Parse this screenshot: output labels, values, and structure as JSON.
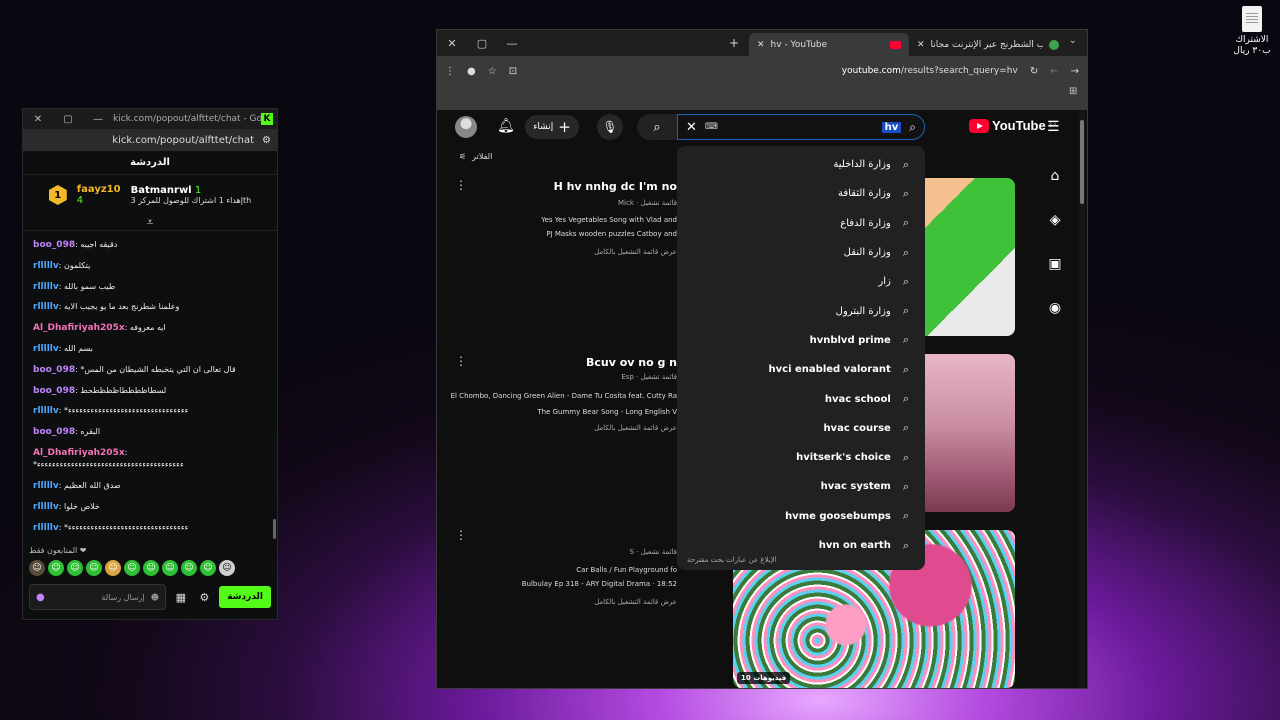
{
  "desktop": {
    "file_label": "الاشتراك ب٣٠ ريال"
  },
  "kick": {
    "window_title": "kick.com/popout/alfttet/chat - Google...",
    "url": "kick.com/popout/alfttet/chat",
    "chat_header": "الدردشة",
    "pinned": {
      "user1": "faayz10",
      "user1_count": "4",
      "user2": "Batmanrwl",
      "user2_count": "1",
      "text": "إهداء 1 اشتراك للوصول للمركز 3",
      "badge_text": "th"
    },
    "messages": [
      {
        "user": "boo_098",
        "color": "#c084fc",
        "text": "دقيقه اجيبه"
      },
      {
        "user": "rlllllv",
        "color": "#4ea8ff",
        "text": "يتكلمون"
      },
      {
        "user": "rlllllv",
        "color": "#4ea8ff",
        "text": "طيب سمو بالله"
      },
      {
        "user": "rlllllv",
        "color": "#4ea8ff",
        "text": "وعلمنا شطرنج بعد ما يو يجيب الايه"
      },
      {
        "user": "Al_Dhafiriyah205x",
        "color": "#f472b6",
        "text": "ايه معروفه"
      },
      {
        "user": "rlllllv",
        "color": "#4ea8ff",
        "text": "بسم الله"
      },
      {
        "user": "boo_098",
        "color": "#c084fc",
        "text": "*قال تعالى ان التي يتخبطه الشيطان من المس"
      },
      {
        "user": "boo_098",
        "color": "#c084fc",
        "text": "لسطاظطظطاظطظطحط"
      },
      {
        "user": "rlllllv",
        "color": "#4ea8ff",
        "text": "*ءءءءءءءءءءءءءءءءءءءءءءءءءءءءءءءء"
      },
      {
        "user": "boo_098",
        "color": "#c084fc",
        "text": "البقره"
      },
      {
        "user": "Al_Dhafiriyah205x",
        "color": "#f472b6",
        "text": "*ءءءءءءءءءءءءءءءءءءءءءءءءءءءءءءءءءءءءءءء"
      },
      {
        "user": "rlllllv",
        "color": "#4ea8ff",
        "text": "صدق الله العظيم"
      },
      {
        "user": "rlllllv",
        "color": "#4ea8ff",
        "text": "خلاص خلوا"
      },
      {
        "user": "rlllllv",
        "color": "#4ea8ff",
        "text": "*ءءءءءءءءءءءءءءءءءءءءءءءءءءءءءءءء"
      }
    ],
    "emotes_label": "المتابعون فقط ❤",
    "input_placeholder": "إرسال رسالة",
    "send_label": "الدردشة"
  },
  "browser": {
    "tabs": [
      {
        "title": "hv - YouTube",
        "active": true
      },
      {
        "title": "إلعب الشطرنج عبر الإنترنت مجاناً",
        "active": false
      }
    ],
    "url_domain": "youtube.com",
    "url_path": "/results?search_query=hv",
    "youtube": {
      "create_label": "إنشاء",
      "search_value": "hv",
      "keyboard_icon": "⌨",
      "logo_text": "YouTube",
      "region": "SA",
      "filters_label": "الفلاتر",
      "suggestions": [
        "وزارة الداخلية",
        "وزارة الثقافة",
        "وزارة الدفاع",
        "وزارة النقل",
        "زار",
        "وزارة البترول",
        "hvnblvd prime",
        "hvci enabled valorant",
        "hvac school",
        "hvac course",
        "hvitserk's choice",
        "hvac system",
        "hvme goosebumps",
        "hvn on earth"
      ],
      "report_text": "الإبلاغ عن عبارات بحث مقترحة",
      "results": [
        {
          "title": "H hv nnhg dc I'm no",
          "meta": "Mick · قائمة تشغيل",
          "lines": [
            "Yes Yes Vegetables Song with Vlad and",
            "PJ Masks wooden puzzles Catboy and"
          ],
          "full": "عرض قائمة التشغيل بالكامل"
        },
        {
          "title": "Bcuv ov no g n",
          "meta": "Esp · قائمة تشغيل",
          "lines": [
            "El Chombo, Dancing Green Alien - Dame Tu Cosita feat. Cutty Ra",
            "The Gummy Bear Song - Long English V"
          ],
          "full": "عرض قائمة التشغيل بالكامل"
        },
        {
          "title": "",
          "meta": "S · قائمة تشغيل",
          "lines": [
            "Car Balls / Fun Playground fo",
            "Bulbulay Ep 318 - ARY Digital Drama · 18:52"
          ],
          "full": "عرض قائمة التشغيل بالكامل",
          "badge": "10 فيديوهات"
        }
      ]
    }
  }
}
